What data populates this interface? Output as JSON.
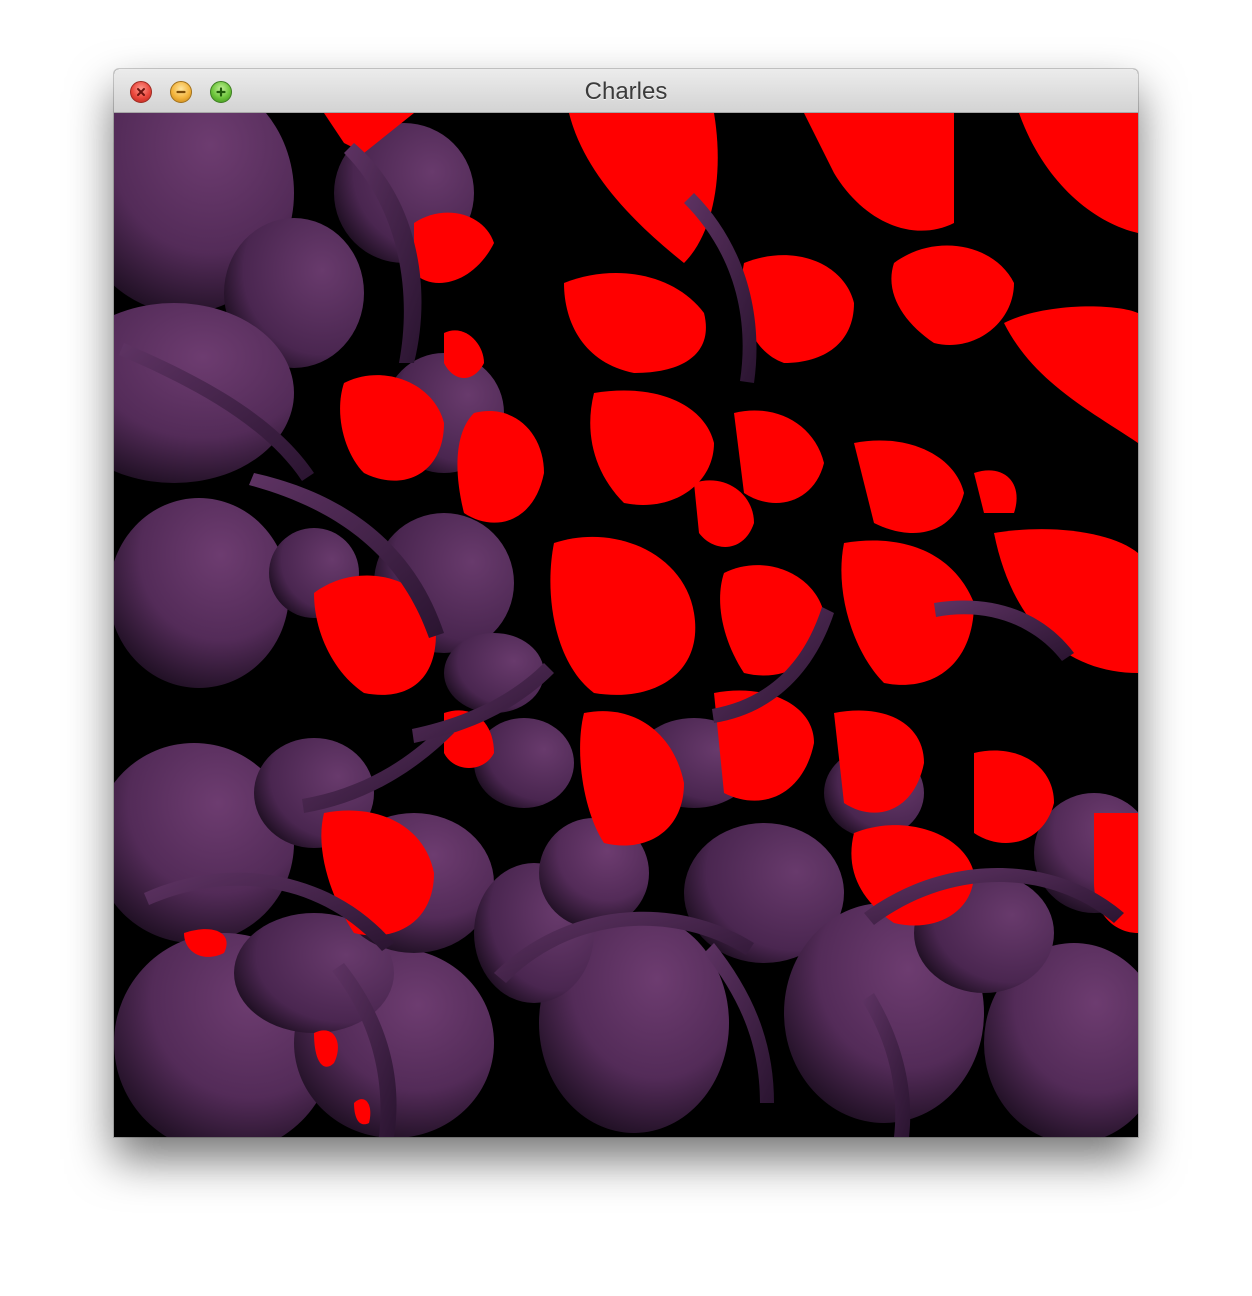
{
  "window": {
    "title": "Charles"
  },
  "titlebar": {
    "buttons": [
      {
        "name": "close",
        "icon": "close-icon",
        "color": "#e9463b"
      },
      {
        "name": "minimize",
        "icon": "minimize-icon",
        "color": "#f3b43c"
      },
      {
        "name": "zoom",
        "icon": "zoom-icon",
        "color": "#6cc43a"
      }
    ]
  },
  "render": {
    "background_color": "#000000",
    "sphere_color": "#6a3a6e",
    "highlight_color": "#ff0000"
  }
}
